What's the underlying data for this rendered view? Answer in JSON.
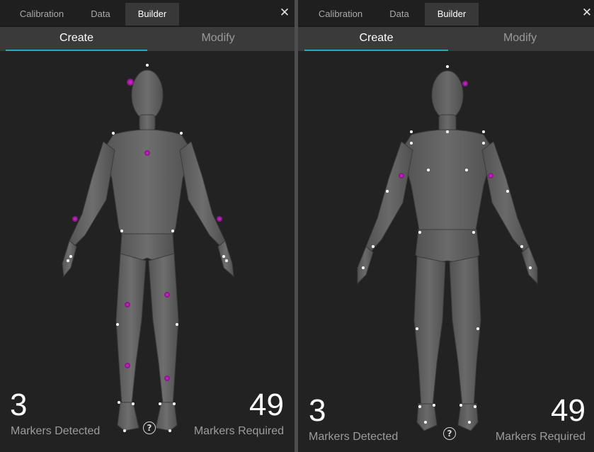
{
  "colors": {
    "accent": "#27aac4",
    "marker": "#ffffff",
    "marker_missing": "#c020c0",
    "panel_bg": "#222222"
  },
  "tabs": [
    "Calibration",
    "Data",
    "Builder"
  ],
  "active_tab": "Builder",
  "subtabs": [
    "Create",
    "Modify"
  ],
  "active_subtab": "Create",
  "close_icon": "close-icon",
  "help_icon": "help-icon",
  "panels": [
    {
      "view": "front",
      "markers_detected": "3",
      "markers_detected_label": "Markers Detected",
      "markers_required": "49",
      "markers_required_label": "Markers Required"
    },
    {
      "view": "back",
      "markers_detected": "3",
      "markers_detected_label": "Markers Detected",
      "markers_required": "49",
      "markers_required_label": "Markers Required"
    }
  ]
}
